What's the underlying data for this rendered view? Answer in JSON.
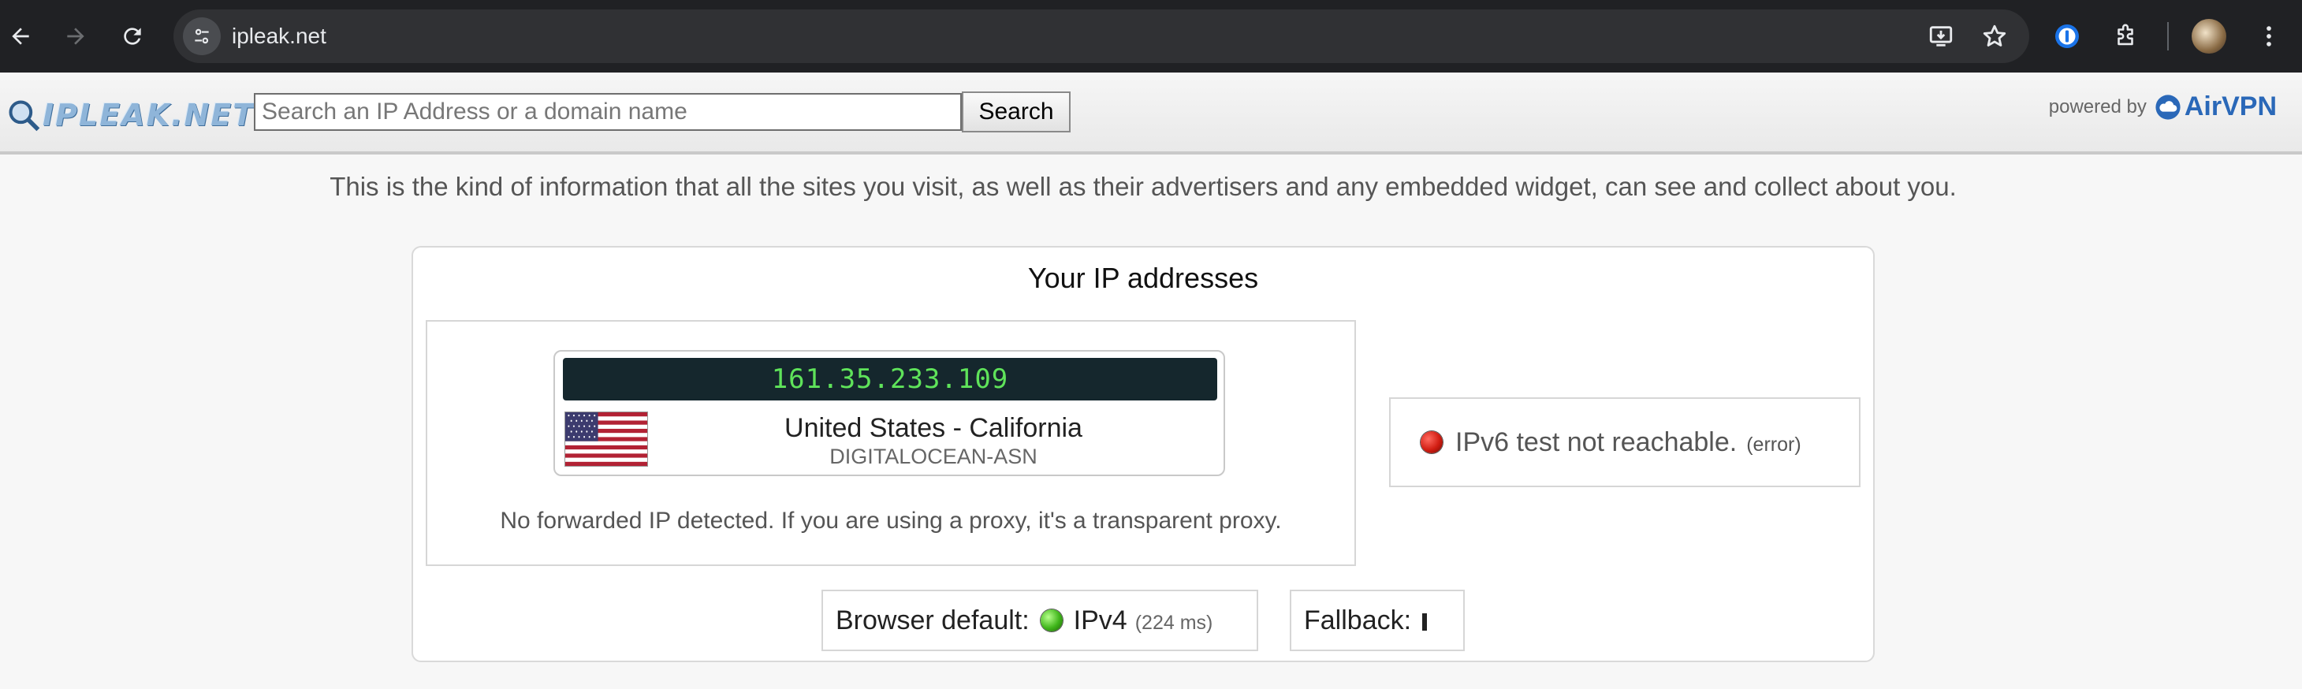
{
  "browser": {
    "url": "ipleak.net"
  },
  "header": {
    "logo_text": "IPLEAK.NET",
    "search_placeholder": "Search an IP Address or a domain name",
    "search_value": "",
    "search_button": "Search",
    "powered_by": "powered by",
    "airvpn": "AirVPN"
  },
  "tagline": "This is the kind of information that all the sites you visit, as well as their advertisers and any embedded widget, can see and collect about you.",
  "ip_panel": {
    "title": "Your IP addresses",
    "ipv4": {
      "ip": "161.35.233.109",
      "location": "United States - California",
      "asn": "DIGITALOCEAN-ASN",
      "forwarded_note": "No forwarded IP detected. If you are using a proxy, it's a transparent proxy."
    },
    "ipv6": {
      "status_color": "#d11d12",
      "message": "IPv6 test not reachable.",
      "detail": "(error)"
    },
    "browser_default": {
      "label": "Browser default:",
      "status_color": "#3fb51a",
      "protocol": "IPv4",
      "latency": "(224 ms)"
    },
    "fallback": {
      "label": "Fallback:"
    }
  }
}
